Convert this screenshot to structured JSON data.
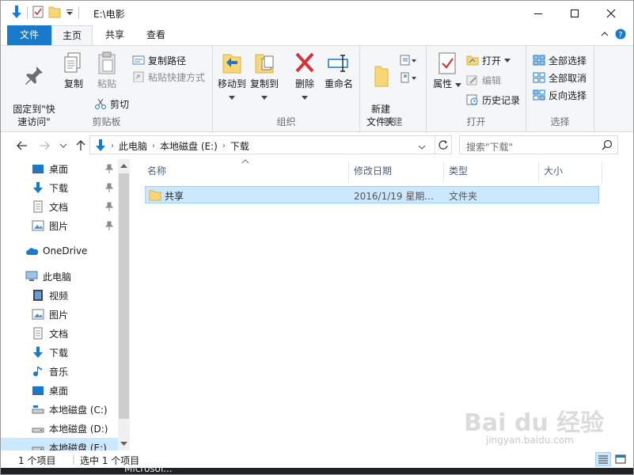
{
  "window": {
    "title": "E:\\电影"
  },
  "ribbon_tabs": [
    "文件",
    "主页",
    "共享",
    "查看"
  ],
  "ribbon": {
    "clipboard": {
      "label": "剪贴板",
      "pin_quick_access": "固定到\"快\n速访问\"",
      "copy": "复制",
      "paste": "粘贴",
      "copy_path": "复制路径",
      "paste_shortcut": "粘贴快捷方式",
      "cut": "剪切"
    },
    "organize": {
      "label": "组织",
      "move_to": "移动到",
      "copy_to": "复制到",
      "delete": "删除",
      "rename": "重命名"
    },
    "new": {
      "label": "新建",
      "new_folder": "新建\n文件夹"
    },
    "open": {
      "label": "打开",
      "properties": "属性",
      "open": "打开",
      "edit": "编辑",
      "history": "历史记录"
    },
    "select": {
      "label": "选择",
      "select_all": "全部选择",
      "select_none": "全部取消",
      "invert": "反向选择"
    }
  },
  "address": {
    "crumbs": [
      "此电脑",
      "本地磁盘 (E:)",
      "下载"
    ],
    "search_placeholder": "搜索\"下载\""
  },
  "nav": {
    "quick": [
      {
        "label": "桌面",
        "icon": "desktop-icon"
      },
      {
        "label": "下载",
        "icon": "download-icon"
      },
      {
        "label": "文档",
        "icon": "document-icon"
      },
      {
        "label": "图片",
        "icon": "picture-icon"
      }
    ],
    "onedrive": "OneDrive",
    "this_pc": "此电脑",
    "pc_items": [
      {
        "label": "视频",
        "icon": "video-icon"
      },
      {
        "label": "图片",
        "icon": "picture-icon"
      },
      {
        "label": "文档",
        "icon": "document-icon"
      },
      {
        "label": "下载",
        "icon": "download-icon"
      },
      {
        "label": "音乐",
        "icon": "music-icon"
      },
      {
        "label": "桌面",
        "icon": "desktop-icon"
      },
      {
        "label": "本地磁盘 (C:)",
        "icon": "drive-icon"
      },
      {
        "label": "本地磁盘 (D:)",
        "icon": "drive-icon"
      },
      {
        "label": "本地磁盘 (E:)",
        "icon": "drive-icon"
      }
    ]
  },
  "columns": [
    "名称",
    "修改日期",
    "类型",
    "大小"
  ],
  "files": [
    {
      "name": "共享",
      "modified": "2016/1/19 星期...",
      "type": "文件夹",
      "size": ""
    }
  ],
  "status": {
    "item_count": "1 个项目",
    "selected": "选中 1 个项目"
  },
  "taskbar_text": "Microsof...",
  "watermark": {
    "brand": "Bai du 经验",
    "site": "jingyan.baidu.com"
  }
}
